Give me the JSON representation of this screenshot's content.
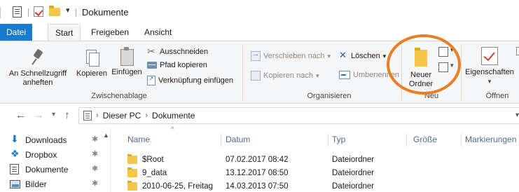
{
  "window": {
    "title": "Dokumente",
    "quick_access_dropdown": "▾"
  },
  "tabs": [
    {
      "label": "Datei"
    },
    {
      "label": "Start"
    },
    {
      "label": "Freigeben"
    },
    {
      "label": "Ansicht"
    }
  ],
  "ribbon": {
    "clipboard": {
      "group_label": "Zwischenablage",
      "pin_quick_access": "An Schnellzugriff anheften",
      "copy": "Kopieren",
      "paste": "Einfügen",
      "cut": "Ausschneiden",
      "copy_path": "Pfad kopieren",
      "paste_shortcut": "Verknüpfung einfügen"
    },
    "organize": {
      "group_label": "Organisieren",
      "move_to": "Verschieben nach",
      "copy_to": "Kopieren nach",
      "delete": "Löschen",
      "rename": "Umbenennen"
    },
    "new": {
      "group_label": "Neu",
      "new_folder": "Neuer Ordner"
    },
    "open": {
      "group_label": "Öffnen",
      "properties": "Eigenschaften"
    },
    "highlight_color": "#ec7d22"
  },
  "address": {
    "segments": [
      "Dieser PC",
      "Dokumente"
    ],
    "separator": "›"
  },
  "sidebar": {
    "items": [
      {
        "label": "Downloads",
        "icon": "download-icon"
      },
      {
        "label": "Dropbox",
        "icon": "dropbox-icon"
      },
      {
        "label": "Dokumente",
        "icon": "documents-icon"
      },
      {
        "label": "Bilder",
        "icon": "pictures-icon"
      }
    ],
    "pin_glyph": "✱"
  },
  "filelist": {
    "columns": [
      "Name",
      "Datum",
      "Typ",
      "Größe",
      "Markierungen"
    ],
    "rows": [
      {
        "name": "$Root",
        "date": "07.02.2017 08:42",
        "type": "Dateiordner"
      },
      {
        "name": "9_data",
        "date": "13.12.2017 08:50",
        "type": "Dateiordner"
      },
      {
        "name": "2010-06-25, Freitag",
        "date": "14.03.2013 07:50",
        "type": "Dateiordner"
      }
    ]
  },
  "colors": {
    "file_tab": "#1979ca",
    "column_header_text": "#4d6c8e",
    "folder": "#f6c64a"
  }
}
